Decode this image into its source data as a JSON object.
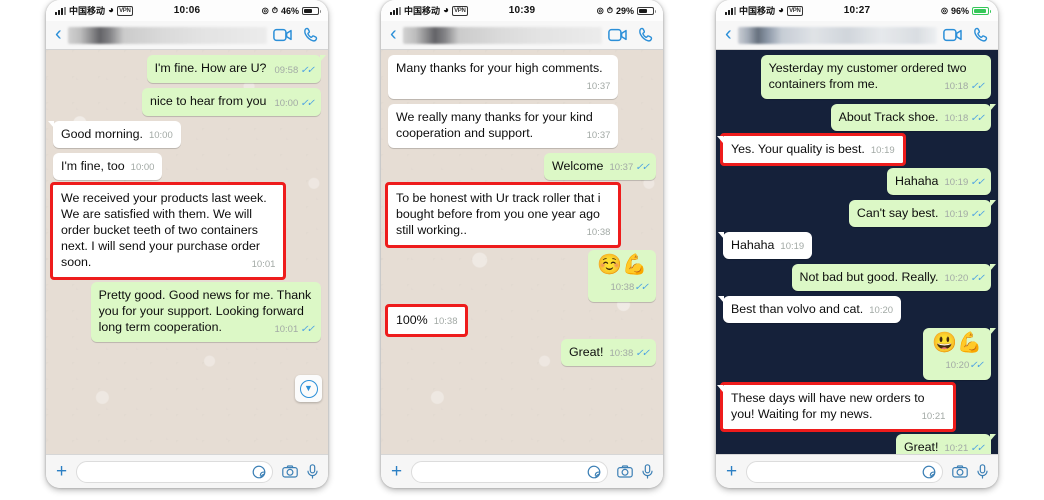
{
  "app": "WhatsApp",
  "phones": [
    {
      "id": "phone-1",
      "status": {
        "carrier": "中国移动",
        "vpn": "VPN",
        "time": "10:06",
        "battery_pct": "46%",
        "battery_level": 46,
        "battery_green": false
      },
      "nav": {
        "back": "‹",
        "video_icon": "video-call-icon",
        "phone_icon": "voice-call-icon"
      },
      "background": "doodle",
      "scroll_button": "scroll-to-bottom",
      "messages": [
        {
          "side": "out",
          "text": "I'm fine. How are U?",
          "time": "09:58",
          "ticks": "read",
          "tail": true,
          "meta_float": true
        },
        {
          "side": "out",
          "text": "nice to hear from you",
          "time": "10:00",
          "ticks": "read",
          "tail": false,
          "meta_float": true
        },
        {
          "side": "in",
          "text": "Good morning.",
          "time": "10:00",
          "ticks": "none",
          "tail": true,
          "meta_float": false
        },
        {
          "side": "in",
          "text": "I'm fine, too",
          "time": "10:00",
          "ticks": "none",
          "tail": false,
          "meta_float": false
        },
        {
          "side": "in",
          "text": "We received your products last week. We are satisfied with them. We will order bucket teeth of two containers next. I will send your purchase order soon.",
          "time": "10:01",
          "ticks": "none",
          "tail": false,
          "highlighted": true,
          "meta_float": true
        },
        {
          "side": "out",
          "text": "Pretty good. Good news for me. Thank you for your support. Looking forward long term cooperation.",
          "time": "10:01",
          "ticks": "read",
          "tail": false,
          "meta_float": true
        }
      ],
      "input": {
        "placeholder": "",
        "plus": "+",
        "sticker_icon": "sticker-icon",
        "camera_icon": "camera-icon",
        "mic_icon": "microphone-icon"
      }
    },
    {
      "id": "phone-2",
      "status": {
        "carrier": "中国移动",
        "vpn": "VPN",
        "time": "10:39",
        "battery_pct": "29%",
        "battery_level": 29,
        "battery_green": false
      },
      "nav": {
        "back": "‹",
        "video_icon": "video-call-icon",
        "phone_icon": "voice-call-icon"
      },
      "background": "doodle",
      "messages": [
        {
          "side": "in",
          "text": "Many thanks for your high comments.",
          "time": "10:37",
          "ticks": "none",
          "tail": false,
          "meta_float": true
        },
        {
          "side": "in",
          "text": "We really many thanks for your kind cooperation and support.",
          "time": "10:37",
          "ticks": "none",
          "tail": false,
          "meta_float": true
        },
        {
          "side": "out",
          "text": "Welcome",
          "time": "10:37",
          "ticks": "read",
          "tail": false,
          "meta_float": false
        },
        {
          "side": "in",
          "text": "To be honest with Ur track roller that i bought before from you one year ago still working..",
          "time": "10:38",
          "ticks": "none",
          "tail": false,
          "highlighted": true,
          "meta_float": true
        },
        {
          "side": "out",
          "emoji": "☺️💪",
          "time": "10:38",
          "ticks": "read",
          "tail": false,
          "is_emoji": true
        },
        {
          "side": "in",
          "text": "100%",
          "time": "10:38",
          "ticks": "none",
          "tail": false,
          "highlighted": true,
          "meta_float": false
        },
        {
          "side": "out",
          "text": "Great!",
          "time": "10:38",
          "ticks": "read",
          "tail": false,
          "meta_float": false
        }
      ],
      "input": {
        "placeholder": "",
        "plus": "+",
        "sticker_icon": "sticker-icon",
        "camera_icon": "camera-icon",
        "mic_icon": "microphone-icon"
      }
    },
    {
      "id": "phone-3",
      "status": {
        "carrier": "中国移动",
        "vpn": "VPN",
        "time": "10:27",
        "battery_pct": "96%",
        "battery_level": 96,
        "battery_green": true
      },
      "nav": {
        "back": "‹",
        "video_icon": "video-call-icon",
        "phone_icon": "voice-call-icon"
      },
      "background": "aurora",
      "messages": [
        {
          "side": "out",
          "text": "Yesterday my customer ordered two containers from me.",
          "time": "10:18",
          "ticks": "read",
          "tail": false,
          "meta_float": true
        },
        {
          "side": "out",
          "text": "About Track shoe.",
          "time": "10:18",
          "ticks": "read",
          "tail": true,
          "meta_float": false
        },
        {
          "side": "in",
          "text": "Yes. Your quality is best.",
          "time": "10:19",
          "ticks": "none",
          "tail": true,
          "highlighted": true,
          "meta_float": false
        },
        {
          "side": "out",
          "text": "Hahaha",
          "time": "10:19",
          "ticks": "read",
          "tail": false,
          "meta_float": false
        },
        {
          "side": "out",
          "text": "Can't say best.",
          "time": "10:19",
          "ticks": "read",
          "tail": true,
          "meta_float": false
        },
        {
          "side": "in",
          "text": "Hahaha",
          "time": "10:19",
          "ticks": "none",
          "tail": true,
          "meta_float": false
        },
        {
          "side": "out",
          "text": "Not bad but good. Really.",
          "time": "10:20",
          "ticks": "read",
          "tail": true,
          "meta_float": false
        },
        {
          "side": "in",
          "text": "Best than volvo and cat.",
          "time": "10:20",
          "ticks": "none",
          "tail": true,
          "meta_float": false
        },
        {
          "side": "out",
          "emoji": "😃💪",
          "time": "10:20",
          "ticks": "read",
          "tail": true,
          "is_emoji": true
        },
        {
          "side": "in",
          "text": "These days will have new orders to you! Waiting for my news.",
          "time": "10:21",
          "ticks": "none",
          "tail": true,
          "highlighted": true,
          "meta_float": true
        },
        {
          "side": "out",
          "text": "Great!",
          "time": "10:21",
          "ticks": "read",
          "tail": true,
          "meta_float": false
        }
      ],
      "input": {
        "placeholder": "",
        "plus": "+",
        "sticker_icon": "sticker-icon",
        "camera_icon": "camera-icon",
        "mic_icon": "microphone-icon"
      }
    }
  ],
  "colors": {
    "outgoing_bubble": "#dcf8c6",
    "incoming_bubble": "#ffffff",
    "highlight_box": "#ee1c1c",
    "accent_blue": "#2b8fd8",
    "tick_blue": "#4fa3e3",
    "doodle_bg": "#e6ddd4"
  }
}
